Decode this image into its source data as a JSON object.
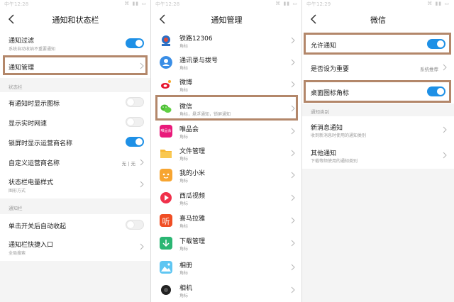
{
  "status_time": "中午12:28",
  "status_time_2": "中午12:29",
  "status_icons": "⌘ ▮▮ ▭",
  "panel1": {
    "title": "通知和状态栏",
    "filter_label": "通知过滤",
    "filter_sub": "系统自动收纳不重要通知",
    "manage_label": "通知管理",
    "section_statusbar": "状态栏",
    "show_icon_label": "有通知时显示图标",
    "speed_label": "显示实时网速",
    "lock_carrier_label": "锁屏时显示运营商名称",
    "custom_carrier_label": "自定义运营商名称",
    "custom_carrier_value": "无 | 无",
    "battery_label": "状态栏电量样式",
    "battery_sub": "图形方式",
    "section_shade": "通知栏",
    "auto_collapse_label": "单击开关后自动收起",
    "shortcut_label": "通知栏快捷入口",
    "shortcut_sub": "全局搜索"
  },
  "panel2": {
    "title": "通知管理",
    "apps": [
      {
        "name": "铁路12306",
        "sub": "角标",
        "icon": "railway-12306-icon"
      },
      {
        "name": "通讯录与拨号",
        "sub": "角标",
        "icon": "contacts-icon"
      },
      {
        "name": "微博",
        "sub": "角标",
        "icon": "weibo-icon"
      },
      {
        "name": "微信",
        "sub": "角标，悬浮通知，锁屏通知",
        "icon": "wechat-icon"
      },
      {
        "name": "唯品会",
        "sub": "角标",
        "icon": "vipshop-icon"
      },
      {
        "name": "文件管理",
        "sub": "角标",
        "icon": "file-manager-icon"
      },
      {
        "name": "我的小米",
        "sub": "角标",
        "icon": "my-xiaomi-icon"
      },
      {
        "name": "西瓜视频",
        "sub": "角标",
        "icon": "xigua-video-icon"
      },
      {
        "name": "喜马拉雅",
        "sub": "角标",
        "icon": "ximalaya-icon"
      },
      {
        "name": "下载管理",
        "sub": "角标",
        "icon": "download-manager-icon"
      },
      {
        "name": "相册",
        "sub": "角标",
        "icon": "gallery-icon"
      },
      {
        "name": "相机",
        "sub": "角标",
        "icon": "camera-icon"
      }
    ],
    "vip_icon_text": "唯品会",
    "ximalaya_icon_text": "听"
  },
  "panel3": {
    "title": "微信",
    "allow_label": "允许通知",
    "important_label": "是否设为重要",
    "important_value": "系统推荐",
    "badge_label": "桌面图标角标",
    "section_categories": "通知类别",
    "new_msg_label": "新消息通知",
    "new_msg_sub": "收到新消息时使用的通知类别",
    "other_label": "其他通知",
    "other_sub": "下载等频使用的通知类别"
  },
  "colors": {
    "accent": "#1e90e6",
    "highlight_box": "#b3876a"
  }
}
